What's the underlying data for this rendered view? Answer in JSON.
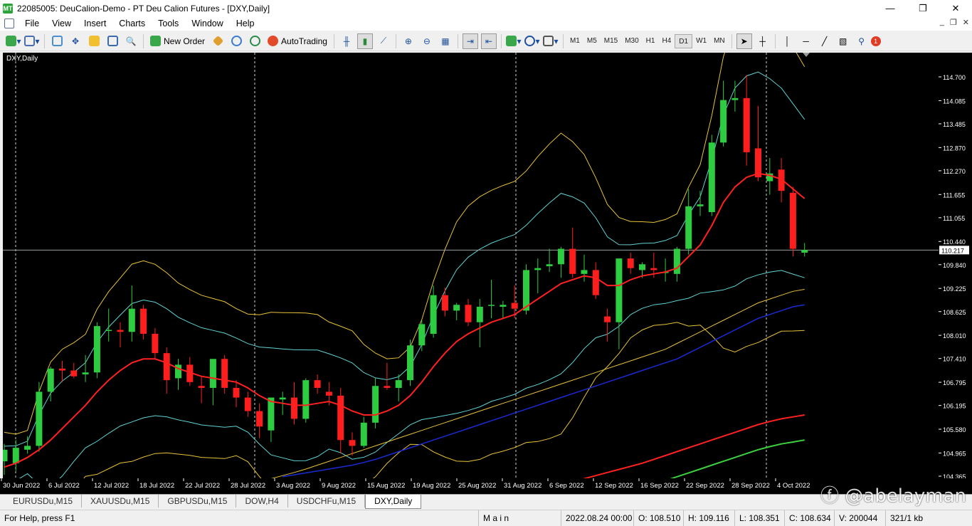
{
  "window": {
    "title": "22085005: DeuCalion-Demo - PT Deu Calion Futures - [DXY,Daily]",
    "app_icon_text": "MT",
    "minimize": "—",
    "maximize": "❐",
    "close": "✕"
  },
  "menu": {
    "items": [
      "File",
      "View",
      "Insert",
      "Charts",
      "Tools",
      "Window",
      "Help"
    ],
    "mdi_minimize": "_",
    "mdi_restore": "❐",
    "mdi_close": "✕"
  },
  "toolbar": {
    "new_order": "New Order",
    "autotrading": "AutoTrading",
    "timeframes": [
      "M1",
      "M5",
      "M15",
      "M30",
      "H1",
      "H4",
      "D1",
      "W1",
      "MN"
    ],
    "active_timeframe": "D1",
    "alerts_count": "1"
  },
  "chart": {
    "label": "DXY,Daily",
    "current_price": "110.217"
  },
  "chart_data": {
    "type": "candlestick",
    "symbol": "DXY",
    "timeframe": "Daily",
    "ylim": [
      104.365,
      115.0
    ],
    "price_ticks": [
      "114.700",
      "114.085",
      "113.485",
      "112.870",
      "112.270",
      "111.655",
      "111.055",
      "110.440",
      "109.840",
      "109.225",
      "108.625",
      "108.010",
      "107.410",
      "106.795",
      "106.195",
      "105.580",
      "104.965",
      "104.365"
    ],
    "time_labels": [
      "30 Jun 2022",
      "6 Jul 2022",
      "12 Jul 2022",
      "18 Jul 2022",
      "22 Jul 2022",
      "28 Jul 2022",
      "3 Aug 2022",
      "9 Aug 2022",
      "15 Aug 2022",
      "19 Aug 2022",
      "25 Aug 2022",
      "31 Aug 2022",
      "6 Sep 2022",
      "12 Sep 2022",
      "16 Sep 2022",
      "22 Sep 2022",
      "28 Sep 2022",
      "4 Oct 2022"
    ],
    "candles": [
      {
        "o": 104.75,
        "h": 105.2,
        "l": 104.4,
        "c": 105.05
      },
      {
        "o": 104.7,
        "h": 105.3,
        "l": 104.5,
        "c": 105.1
      },
      {
        "o": 105.05,
        "h": 105.4,
        "l": 104.95,
        "c": 105.15
      },
      {
        "o": 105.15,
        "h": 106.8,
        "l": 105.0,
        "c": 106.55
      },
      {
        "o": 106.55,
        "h": 107.2,
        "l": 106.3,
        "c": 107.15
      },
      {
        "o": 107.15,
        "h": 107.35,
        "l": 106.8,
        "c": 107.1
      },
      {
        "o": 107.1,
        "h": 107.3,
        "l": 106.9,
        "c": 106.95
      },
      {
        "o": 107.0,
        "h": 107.5,
        "l": 106.8,
        "c": 107.05
      },
      {
        "o": 107.05,
        "h": 108.35,
        "l": 106.9,
        "c": 108.25
      },
      {
        "o": 108.15,
        "h": 108.7,
        "l": 107.85,
        "c": 108.15
      },
      {
        "o": 108.15,
        "h": 108.35,
        "l": 107.7,
        "c": 108.1
      },
      {
        "o": 108.1,
        "h": 109.3,
        "l": 107.85,
        "c": 108.7
      },
      {
        "o": 108.7,
        "h": 108.8,
        "l": 107.9,
        "c": 108.05
      },
      {
        "o": 108.05,
        "h": 108.2,
        "l": 107.4,
        "c": 107.55
      },
      {
        "o": 107.55,
        "h": 107.7,
        "l": 106.5,
        "c": 106.85
      },
      {
        "o": 106.9,
        "h": 107.4,
        "l": 106.6,
        "c": 107.25
      },
      {
        "o": 107.25,
        "h": 107.45,
        "l": 106.7,
        "c": 106.8
      },
      {
        "o": 106.7,
        "h": 106.95,
        "l": 106.25,
        "c": 106.65
      },
      {
        "o": 106.65,
        "h": 107.05,
        "l": 106.2,
        "c": 107.4
      },
      {
        "o": 107.4,
        "h": 107.5,
        "l": 106.5,
        "c": 106.65
      },
      {
        "o": 106.65,
        "h": 106.85,
        "l": 106.15,
        "c": 106.4
      },
      {
        "o": 106.4,
        "h": 106.55,
        "l": 105.9,
        "c": 106.05
      },
      {
        "o": 106.05,
        "h": 106.25,
        "l": 105.35,
        "c": 105.65
      },
      {
        "o": 105.55,
        "h": 106.4,
        "l": 105.25,
        "c": 106.4
      },
      {
        "o": 106.35,
        "h": 106.55,
        "l": 105.95,
        "c": 106.4
      },
      {
        "o": 106.4,
        "h": 106.8,
        "l": 105.7,
        "c": 105.85
      },
      {
        "o": 105.85,
        "h": 106.9,
        "l": 105.75,
        "c": 106.85
      },
      {
        "o": 106.85,
        "h": 107.0,
        "l": 106.5,
        "c": 106.65
      },
      {
        "o": 106.55,
        "h": 106.8,
        "l": 106.2,
        "c": 106.45
      },
      {
        "o": 106.45,
        "h": 106.65,
        "l": 104.95,
        "c": 105.3
      },
      {
        "o": 105.3,
        "h": 105.5,
        "l": 104.9,
        "c": 105.15
      },
      {
        "o": 105.15,
        "h": 105.9,
        "l": 105.1,
        "c": 105.75
      },
      {
        "o": 105.75,
        "h": 106.9,
        "l": 105.6,
        "c": 106.7
      },
      {
        "o": 106.7,
        "h": 107.3,
        "l": 106.6,
        "c": 106.65
      },
      {
        "o": 106.65,
        "h": 107.0,
        "l": 106.3,
        "c": 106.85
      },
      {
        "o": 106.85,
        "h": 107.9,
        "l": 106.7,
        "c": 107.75
      },
      {
        "o": 107.75,
        "h": 108.4,
        "l": 107.6,
        "c": 108.3
      },
      {
        "o": 108.05,
        "h": 109.3,
        "l": 107.95,
        "c": 109.05
      },
      {
        "o": 109.05,
        "h": 109.25,
        "l": 108.5,
        "c": 108.65
      },
      {
        "o": 108.65,
        "h": 108.85,
        "l": 108.4,
        "c": 108.8
      },
      {
        "o": 108.8,
        "h": 108.95,
        "l": 108.25,
        "c": 108.35
      },
      {
        "o": 108.35,
        "h": 108.95,
        "l": 107.7,
        "c": 108.75
      },
      {
        "o": 108.8,
        "h": 109.45,
        "l": 108.45,
        "c": 108.8
      },
      {
        "o": 108.75,
        "h": 108.9,
        "l": 108.45,
        "c": 108.8
      },
      {
        "o": 108.85,
        "h": 109.3,
        "l": 108.45,
        "c": 108.7
      },
      {
        "o": 108.65,
        "h": 109.85,
        "l": 108.55,
        "c": 109.7
      },
      {
        "o": 109.7,
        "h": 110.0,
        "l": 109.1,
        "c": 109.75
      },
      {
        "o": 109.8,
        "h": 110.25,
        "l": 109.65,
        "c": 109.85
      },
      {
        "o": 109.85,
        "h": 110.3,
        "l": 109.5,
        "c": 110.25
      },
      {
        "o": 110.25,
        "h": 110.8,
        "l": 109.5,
        "c": 109.6
      },
      {
        "o": 109.6,
        "h": 110.1,
        "l": 109.4,
        "c": 109.7
      },
      {
        "o": 109.7,
        "h": 109.9,
        "l": 108.95,
        "c": 109.05
      },
      {
        "o": 108.5,
        "h": 108.7,
        "l": 107.85,
        "c": 108.35
      },
      {
        "o": 108.35,
        "h": 110.0,
        "l": 107.65,
        "c": 110.0
      },
      {
        "o": 110.0,
        "h": 110.15,
        "l": 109.6,
        "c": 109.75
      },
      {
        "o": 109.7,
        "h": 109.9,
        "l": 109.5,
        "c": 109.85
      },
      {
        "o": 109.75,
        "h": 110.15,
        "l": 109.5,
        "c": 109.7
      },
      {
        "o": 109.65,
        "h": 110.0,
        "l": 109.4,
        "c": 109.65
      },
      {
        "o": 109.6,
        "h": 110.3,
        "l": 109.4,
        "c": 110.25
      },
      {
        "o": 110.25,
        "h": 111.8,
        "l": 110.1,
        "c": 111.35
      },
      {
        "o": 111.35,
        "h": 111.75,
        "l": 111.1,
        "c": 111.4
      },
      {
        "o": 111.2,
        "h": 113.2,
        "l": 111.1,
        "c": 113.0
      },
      {
        "o": 113.0,
        "h": 114.6,
        "l": 112.9,
        "c": 114.1
      },
      {
        "o": 114.1,
        "h": 114.6,
        "l": 113.8,
        "c": 114.15
      },
      {
        "o": 114.15,
        "h": 114.75,
        "l": 112.4,
        "c": 112.75
      },
      {
        "o": 112.85,
        "h": 113.95,
        "l": 112.0,
        "c": 112.1
      },
      {
        "o": 112.0,
        "h": 112.6,
        "l": 111.65,
        "c": 112.2
      },
      {
        "o": 112.3,
        "h": 112.6,
        "l": 111.45,
        "c": 111.75
      },
      {
        "o": 111.7,
        "h": 111.85,
        "l": 110.05,
        "c": 110.25
      },
      {
        "o": 110.15,
        "h": 110.4,
        "l": 110.05,
        "c": 110.22
      }
    ],
    "ma_fast": [
      104.6,
      104.7,
      104.85,
      105.05,
      105.3,
      105.6,
      105.9,
      106.2,
      106.55,
      106.85,
      107.1,
      107.3,
      107.4,
      107.4,
      107.3,
      107.15,
      107.05,
      106.95,
      106.9,
      106.85,
      106.8,
      106.65,
      106.45,
      106.3,
      106.25,
      106.2,
      106.2,
      106.25,
      106.3,
      106.2,
      106.05,
      105.95,
      105.95,
      106.05,
      106.2,
      106.45,
      106.8,
      107.2,
      107.55,
      107.85,
      108.05,
      108.2,
      108.35,
      108.45,
      108.55,
      108.75,
      108.95,
      109.15,
      109.35,
      109.45,
      109.55,
      109.5,
      109.3,
      109.3,
      109.45,
      109.55,
      109.6,
      109.65,
      109.75,
      110.05,
      110.35,
      110.85,
      111.45,
      111.85,
      112.1,
      112.2,
      112.15,
      112.05,
      111.8,
      111.55
    ],
    "ma_slow": [
      null,
      null,
      null,
      null,
      null,
      null,
      null,
      null,
      null,
      null,
      null,
      null,
      null,
      null,
      null,
      null,
      null,
      null,
      null,
      null,
      null,
      null,
      null,
      null,
      104.35,
      104.4,
      104.45,
      104.5,
      104.55,
      104.6,
      104.65,
      104.72,
      104.8,
      104.9,
      105.0,
      105.1,
      105.2,
      105.3,
      105.4,
      105.5,
      105.6,
      105.7,
      105.8,
      105.9,
      106.0,
      106.1,
      106.2,
      106.3,
      106.4,
      106.5,
      106.6,
      106.7,
      106.8,
      106.9,
      107.0,
      107.1,
      107.2,
      107.3,
      107.4,
      107.55,
      107.7,
      107.85,
      108.0,
      108.15,
      108.3,
      108.45,
      108.55,
      108.65,
      108.75,
      108.8
    ],
    "ma_mid": [
      null,
      null,
      null,
      null,
      null,
      null,
      null,
      null,
      null,
      null,
      null,
      null,
      null,
      null,
      null,
      null,
      null,
      null,
      null,
      null,
      null,
      null,
      null,
      104.3,
      104.38,
      104.46,
      104.55,
      104.65,
      104.75,
      104.85,
      104.95,
      105.05,
      105.15,
      105.25,
      105.35,
      105.45,
      105.55,
      105.65,
      105.75,
      105.85,
      105.95,
      106.05,
      106.15,
      106.25,
      106.35,
      106.45,
      106.55,
      106.65,
      106.75,
      106.85,
      106.95,
      107.05,
      107.15,
      107.25,
      107.35,
      107.45,
      107.55,
      107.65,
      107.8,
      107.95,
      108.1,
      108.25,
      108.4,
      108.55,
      108.7,
      108.85,
      108.95,
      109.05,
      109.15,
      109.2
    ],
    "ma_long": [
      null,
      null,
      null,
      null,
      null,
      null,
      null,
      null,
      null,
      null,
      null,
      null,
      null,
      null,
      null,
      null,
      null,
      null,
      null,
      null,
      null,
      null,
      null,
      null,
      null,
      null,
      null,
      null,
      null,
      null,
      null,
      null,
      null,
      null,
      null,
      null,
      null,
      null,
      null,
      null,
      null,
      null,
      null,
      null,
      null,
      null,
      null,
      104.38,
      104.45,
      104.52,
      104.6,
      104.68,
      104.76,
      104.84,
      104.92,
      105.0,
      105.1,
      105.2,
      105.3,
      105.4,
      105.5,
      105.6,
      105.7,
      105.8,
      105.9,
      106.0,
      106.08,
      106.15,
      106.2,
      106.25
    ]
  },
  "symbol_tabs": [
    "EURUSDu,M15",
    "XAUUSDu,M15",
    "GBPUSDu,M15",
    "DOW,H4",
    "USDCHFu,M15",
    "DXY,Daily"
  ],
  "active_tab": "DXY,Daily",
  "watermark": "ⓕ @abelayman",
  "status": {
    "help": "For Help, press F1",
    "profile": "M a i n",
    "datetime": "2022.08.24 00:00",
    "open": "O: 108.510",
    "high": "H: 109.116",
    "low": "L: 108.351",
    "close": "C: 108.634",
    "volume": "V: 200044",
    "traffic": "321/1 kb"
  },
  "colors": {
    "bull": "#2ecc40",
    "bear": "#ff1e1e",
    "ma_red": "#ff2020",
    "ma_blue": "#1a2bd6",
    "ma_green": "#3ecf3e",
    "band_yellow": "#e8c23a",
    "band_cyan": "#5fd3d3",
    "bg": "#000000"
  }
}
